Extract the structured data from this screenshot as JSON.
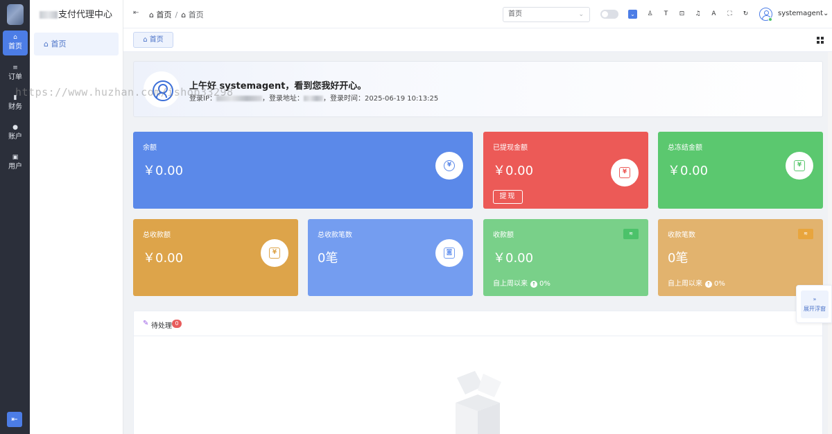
{
  "rail": {
    "items": [
      {
        "label": "首页",
        "icon": "home-icon",
        "glyph": "⌂"
      },
      {
        "label": "订单",
        "icon": "list-icon",
        "glyph": "≡"
      },
      {
        "label": "财务",
        "icon": "finance-icon",
        "glyph": "▮"
      },
      {
        "label": "账户",
        "icon": "account-icon",
        "glyph": "●"
      },
      {
        "label": "用户",
        "icon": "user-icon",
        "glyph": "▣"
      }
    ],
    "collapse_glyph": "⇤"
  },
  "sidebar": {
    "title": "支付代理中心",
    "items": [
      {
        "label": "首页",
        "glyph": "⌂"
      }
    ]
  },
  "header": {
    "fold_glyph": "⇤",
    "breadcrumb": [
      "首页",
      "首页"
    ],
    "breadcrumb_glyph": "⌂",
    "search_select_value": "首页",
    "username": "systemagent",
    "username_chevron": "⌄"
  },
  "tabs": [
    {
      "label": "首页",
      "glyph": "⌂"
    }
  ],
  "welcome": {
    "title": "上午好 systemagent，看到您我好开心。",
    "login_ip_label": "登录IP：",
    "login_addr_label": "，登录地址：",
    "login_time_label": "，登录时间：",
    "login_time": "2025-06-19 10:13:25"
  },
  "watermark": "https://www.huzhan.com/ishop33298",
  "stats": [
    {
      "label": "余额",
      "value": "￥0.00",
      "color": "#5b89e9",
      "icon": "yuan-coin-icon",
      "glyph": "¥"
    },
    {
      "label": "已提现金额",
      "value": "￥0.00",
      "color": "#ec5a57",
      "icon": "yuan-note-icon",
      "glyph": "¥",
      "button": "提现"
    },
    {
      "label": "总冻结金额",
      "value": "￥0.00",
      "color": "#5bc86f",
      "icon": "yuan-note-icon",
      "glyph": "¥"
    },
    {
      "label": "总收款额",
      "value": "￥0.00",
      "color": "#dda44a",
      "icon": "yuan-note-icon",
      "glyph": "¥"
    },
    {
      "label": "总收款笔数",
      "value": "0笔",
      "color": "#749df0",
      "icon": "contact-card-icon",
      "glyph": "◙"
    },
    {
      "label": "收款额",
      "value": "￥0.00",
      "color": "#79d089",
      "icon": "wifi-icon",
      "glyph": "≋",
      "sub_label": "自上周以来",
      "sub_value": "0%",
      "tag_color": "#4cc26a",
      "up_color": "#2f9e4a"
    },
    {
      "label": "收款笔数",
      "value": "0笔",
      "color": "#e2b36e",
      "icon": "wifi-icon",
      "glyph": "≋",
      "sub_label": "自上周以来",
      "sub_value": "0%",
      "tag_color": "#e8a53d",
      "up_color": "#d6891b"
    }
  ],
  "pending": {
    "title": "待处理",
    "count": "0",
    "glyph": "✎"
  },
  "float_widget": {
    "label": "展开浮窗",
    "glyph": "»"
  }
}
